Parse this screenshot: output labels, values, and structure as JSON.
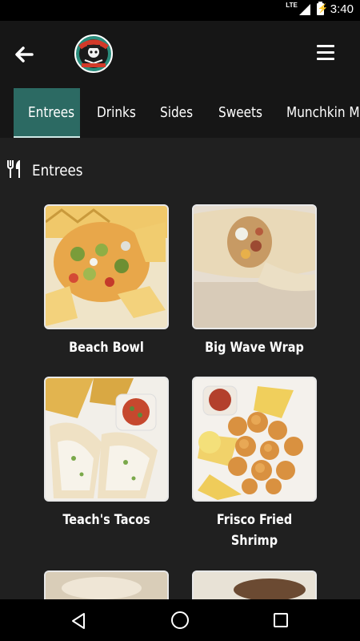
{
  "status_bar": {
    "network": "LTE",
    "time": "3:40"
  },
  "app_bar": {
    "back_icon": "arrow-left-icon",
    "logo_icon": "restaurant-logo-icon",
    "menu_icon": "hamburger-menu-icon"
  },
  "tabs": [
    {
      "label": "Entrees",
      "active": true
    },
    {
      "label": "Drinks",
      "active": false
    },
    {
      "label": "Sides",
      "active": false
    },
    {
      "label": "Sweets",
      "active": false
    },
    {
      "label": "Munchkin Menu",
      "active": false
    }
  ],
  "section": {
    "icon": "fork-knife-icon",
    "title": "Entrees"
  },
  "items": [
    {
      "name": "Beach Bowl"
    },
    {
      "name": "Big Wave Wrap"
    },
    {
      "name": "Teach's Tacos"
    },
    {
      "name": "Frisco Fried Shrimp"
    }
  ],
  "nav_bar": {
    "back": "triangle-back-icon",
    "home": "circle-home-icon",
    "recents": "square-recents-icon"
  },
  "colors": {
    "accent": "#2c6a63",
    "background": "#202020",
    "bar": "#161616"
  }
}
